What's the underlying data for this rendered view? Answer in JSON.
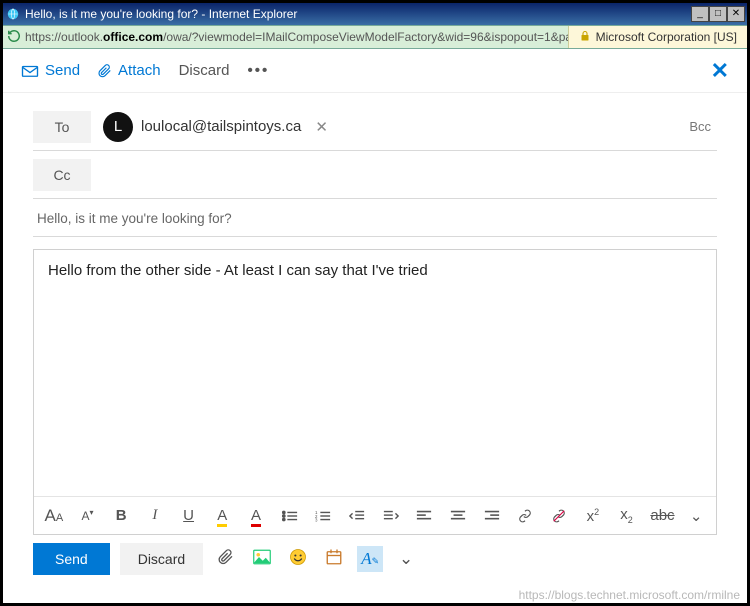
{
  "window": {
    "title": "Hello, is it me you're looking for? - Internet Explorer"
  },
  "addressbar": {
    "url_prefix": "https://outlook.",
    "url_bold": "office.com",
    "url_suffix": "/owa/?viewmodel=IMailComposeViewModelFactory&wid=96&ispopout=1&path=",
    "cert": "Microsoft Corporation [US]"
  },
  "toolbar": {
    "send": "Send",
    "attach": "Attach",
    "discard": "Discard"
  },
  "compose": {
    "to_label": "To",
    "cc_label": "Cc",
    "bcc_label": "Bcc",
    "recipient": {
      "initial": "L",
      "email": "loulocal@tailspintoys.ca"
    },
    "subject": "Hello, is it me you're looking for?",
    "body": "Hello from the other side - At least I can say that I've tried"
  },
  "bottom": {
    "send": "Send",
    "discard": "Discard"
  },
  "watermark": "https://blogs.technet.microsoft.com/rmilne"
}
